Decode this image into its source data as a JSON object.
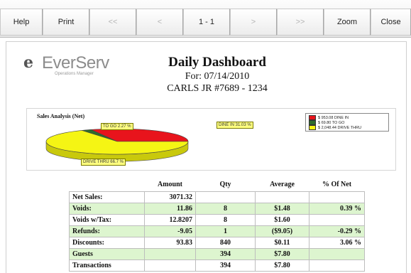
{
  "toolbar": {
    "buttons": [
      {
        "label": "Help",
        "enabled": true
      },
      {
        "label": "Print",
        "enabled": true
      },
      {
        "label": "<<",
        "enabled": false
      },
      {
        "label": "<",
        "enabled": false
      },
      {
        "label": "1 - 1",
        "enabled": true
      },
      {
        "label": ">",
        "enabled": false
      },
      {
        "label": ">>",
        "enabled": false
      },
      {
        "label": "Zoom",
        "enabled": true
      },
      {
        "label": "Close",
        "enabled": true
      }
    ]
  },
  "logo": {
    "mark": "e",
    "word": "EverServ",
    "tagline": "Operations Manager"
  },
  "report": {
    "title": "Daily Dashboard",
    "date_line": "For: 07/14/2010",
    "store_line": "CARLS JR #7689 - 1234"
  },
  "chart_data": {
    "type": "pie",
    "title": "Sales Analysis (Net)",
    "slices": [
      {
        "label": "DINE IN 31.03 %",
        "legend": "$ 953.08 DINE IN",
        "value": 953.08,
        "percent": 31.03,
        "color": "#e8141c"
      },
      {
        "label": "TO GO 2.27 %",
        "legend": "$ 69.80 TO GO",
        "value": 69.8,
        "percent": 2.27,
        "color": "#2e6b2e"
      },
      {
        "label": "DRIVE THRU 66.7 %",
        "legend": "$ 2,048.44 DRIVE THRU",
        "value": 2048.44,
        "percent": 66.7,
        "color": "#f5f514"
      }
    ],
    "legend_position": "top-right"
  },
  "table": {
    "headers": [
      "",
      "Amount",
      "Qty",
      "Average",
      "% Of Net"
    ],
    "rows": [
      {
        "label": "Net Sales:",
        "amount": "3071.32",
        "qty": "",
        "average": "",
        "pct": "",
        "green": false
      },
      {
        "label": "Voids:",
        "amount": "11.86",
        "qty": "8",
        "average": "$1.48",
        "pct": "0.39 %",
        "green": true
      },
      {
        "label": "Voids w/Tax:",
        "amount": "12.8207",
        "qty": "8",
        "average": "$1.60",
        "pct": "",
        "green": false
      },
      {
        "label": "Refunds:",
        "amount": "-9.05",
        "qty": "1",
        "average": "($9.05)",
        "pct": "-0.29 %",
        "green": true
      },
      {
        "label": "Discounts:",
        "amount": "93.83",
        "qty": "840",
        "average": "$0.11",
        "pct": "3.06 %",
        "green": false
      },
      {
        "label": "Guests",
        "amount": "",
        "qty": "394",
        "average": "$7.80",
        "pct": "",
        "green": true
      },
      {
        "label": "Transactions",
        "amount": "",
        "qty": "394",
        "average": "$7.80",
        "pct": "",
        "green": false
      }
    ]
  }
}
